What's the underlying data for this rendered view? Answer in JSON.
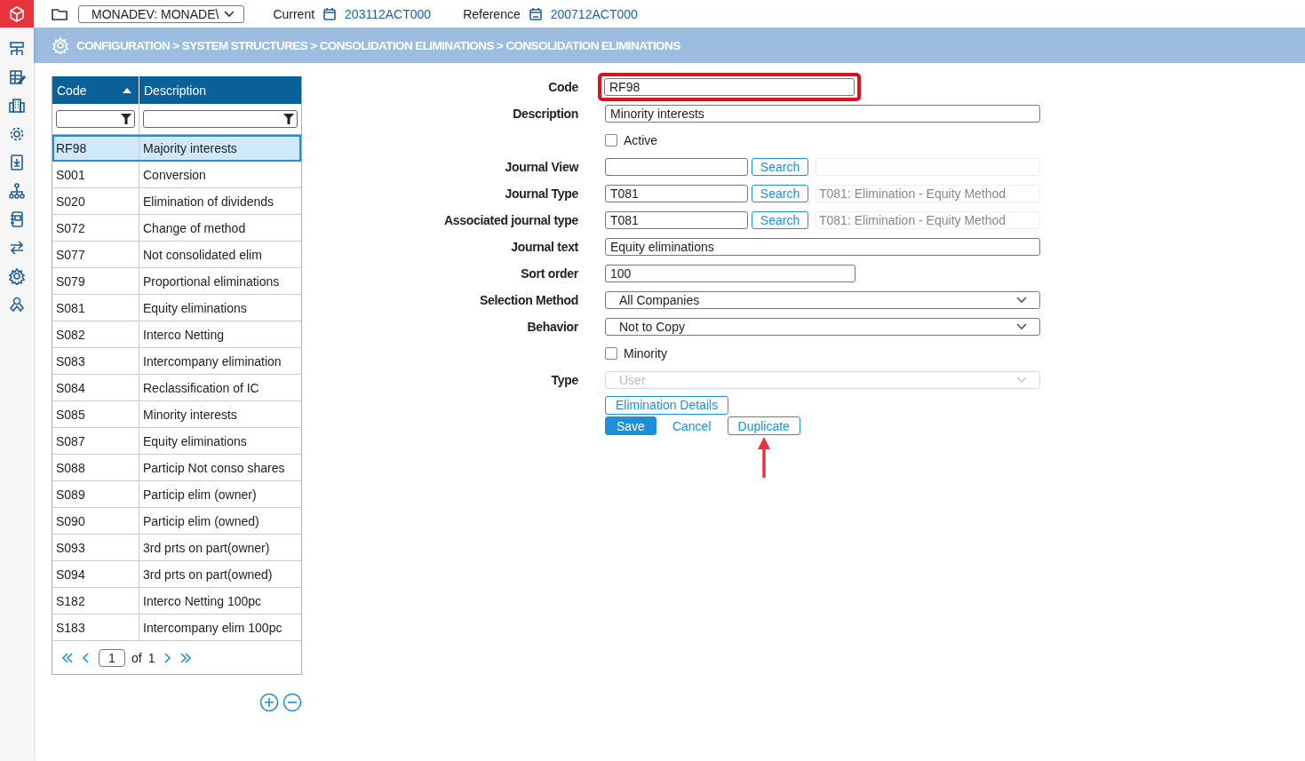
{
  "topbar": {
    "environment": "MONADEV: MONADE\\",
    "current_label": "Current",
    "current_value": "203112ACT000",
    "reference_label": "Reference",
    "reference_value": "200712ACT000"
  },
  "breadcrumb": "CONFIGURATION > SYSTEM STRUCTURES > CONSOLIDATION ELIMINATIONS > CONSOLIDATION ELIMINATIONS",
  "table": {
    "columns": [
      {
        "label": "Code",
        "sorted": true
      },
      {
        "label": "Description",
        "sorted": false
      }
    ],
    "rows": [
      {
        "code": "RF98",
        "description": "Majority interests",
        "selected": true
      },
      {
        "code": "S001",
        "description": "Conversion",
        "selected": false
      },
      {
        "code": "S020",
        "description": "Elimination of dividends",
        "selected": false
      },
      {
        "code": "S072",
        "description": "Change of method",
        "selected": false
      },
      {
        "code": "S077",
        "description": "Not consolidated elim",
        "selected": false
      },
      {
        "code": "S079",
        "description": "Proportional eliminations",
        "selected": false
      },
      {
        "code": "S081",
        "description": "Equity eliminations",
        "selected": false
      },
      {
        "code": "S082",
        "description": "Interco Netting",
        "selected": false
      },
      {
        "code": "S083",
        "description": "Intercompany elimination",
        "selected": false
      },
      {
        "code": "S084",
        "description": "Reclassification of IC",
        "selected": false
      },
      {
        "code": "S085",
        "description": "Minority interests",
        "selected": false
      },
      {
        "code": "S087",
        "description": "Equity eliminations",
        "selected": false
      },
      {
        "code": "S088",
        "description": "Particip Not conso shares",
        "selected": false
      },
      {
        "code": "S089",
        "description": "Particip elim (owner)",
        "selected": false
      },
      {
        "code": "S090",
        "description": "Particip elim (owned)",
        "selected": false
      },
      {
        "code": "S093",
        "description": "3rd prts on part(owner)",
        "selected": false
      },
      {
        "code": "S094",
        "description": "3rd prts on part(owned)",
        "selected": false
      },
      {
        "code": "S182",
        "description": "Interco Netting 100pc",
        "selected": false
      },
      {
        "code": "S183",
        "description": "Intercompany elim 100pc",
        "selected": false
      }
    ],
    "pager": {
      "page": "1",
      "of_label": "of",
      "total": "1"
    }
  },
  "form": {
    "fields": [
      {
        "kind": "short_text",
        "label": "Code",
        "value": "RF98",
        "highlighted": true
      },
      {
        "kind": "text",
        "label": "Description",
        "value": "Minority interests",
        "highlighted": false
      },
      {
        "kind": "checkbox",
        "text": "Active",
        "checked": false
      },
      {
        "kind": "lookup",
        "label": "Journal View",
        "button": "Search"
      },
      {
        "kind": "lookup",
        "label": "Journal Type",
        "value": "T081",
        "button": "Search",
        "lookup_text": "T081: Elimination - Equity Method"
      },
      {
        "kind": "lookup",
        "label": "Associated journal type",
        "value": "T081",
        "button": "Search",
        "lookup_text": "T081: Elimination - Equity Method"
      },
      {
        "kind": "text",
        "label": "Journal text",
        "value": "Equity eliminations",
        "highlighted": false
      },
      {
        "kind": "short_text",
        "label": "Sort order",
        "value": "100",
        "highlighted": false
      },
      {
        "kind": "select",
        "label": "Selection Method",
        "value": "All Companies",
        "disabled": false
      },
      {
        "kind": "select",
        "label": "Behavior",
        "value": "Not to Copy",
        "disabled": false
      },
      {
        "kind": "checkbox",
        "text": "Minority",
        "checked": false
      },
      {
        "kind": "select",
        "label": "Type",
        "value": "User",
        "disabled": true
      }
    ],
    "details_button": "Elimination Details",
    "actions": [
      {
        "kind": "primary",
        "label": "Save",
        "pointer_arrow": false
      },
      {
        "kind": "link",
        "label": "Cancel",
        "pointer_arrow": false
      },
      {
        "kind": "outline",
        "label": "Duplicate",
        "pointer_arrow": true
      }
    ]
  }
}
